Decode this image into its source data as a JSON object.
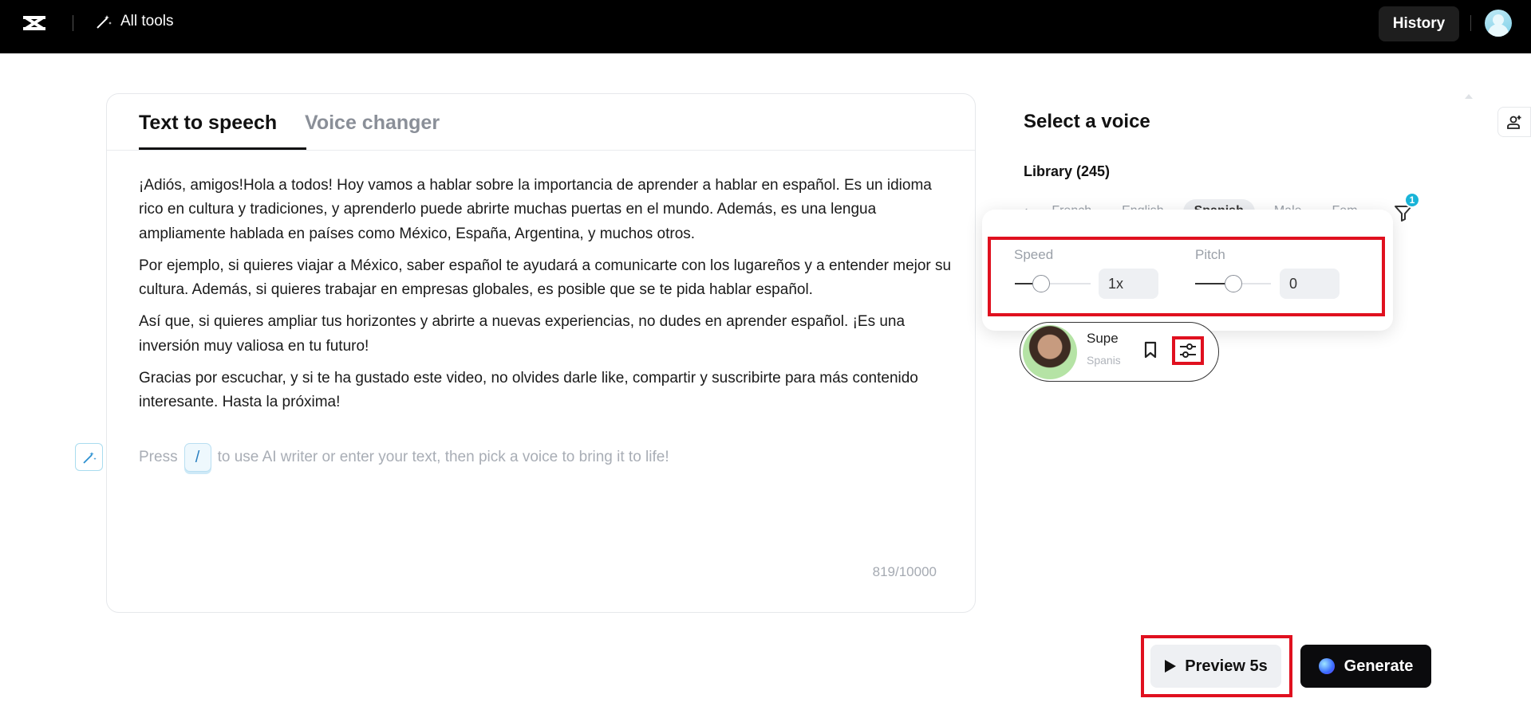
{
  "topbar": {
    "logo_icon": "capcut-logo-icon",
    "all_tools_label": "All tools",
    "all_tools_icon": "magic-wand-icon",
    "history_label": "History",
    "avatar": "user-avatar"
  },
  "editor": {
    "tabs": [
      {
        "label": "Text to speech",
        "active": true
      },
      {
        "label": "Voice changer",
        "active": false
      }
    ],
    "paragraphs": [
      " ¡Adiós, amigos!Hola a todos! Hoy vamos a hablar sobre la importancia de aprender a hablar en español. Es un idioma rico en cultura y tradiciones, y aprenderlo puede abrirte muchas puertas en el mundo. Además, es una lengua ampliamente hablada en países como México, España, Argentina, y muchos otros.",
      "Por ejemplo, si quieres viajar a México, saber español te ayudará a comunicarte con los lugareños y a entender mejor su cultura. Además, si quieres trabajar en empresas globales, es posible que se te pida hablar español.",
      "Así que, si quieres ampliar tus horizontes y abrirte a nuevas experiencias, no dudes en aprender español. ¡Es una inversión muy valiosa en tu futuro!",
      "Gracias por escuchar, y si te ha gustado este video, no olvides darle like, compartir y suscribirte para más contenido interesante. Hasta la próxima!"
    ],
    "placeholder_before": "Press",
    "placeholder_key": "/",
    "placeholder_after": "to use AI writer or enter your text, then pick a voice to bring it to life!",
    "char_count": "819/10000"
  },
  "voice_panel": {
    "title": "Select a voice",
    "library_label": "Library (245)",
    "filter_chips": [
      "French",
      "English",
      "Spanish",
      "Male",
      "Fem"
    ],
    "active_chip": "Spanish",
    "filter_badge": "1",
    "settings_popover": {
      "speed_label": "Speed",
      "speed_value": "1x",
      "speed_level": 0.3,
      "pitch_label": "Pitch",
      "pitch_value": "0",
      "pitch_level": 0.5
    },
    "voice_card": {
      "name": "Supe",
      "language": "Spanis"
    }
  },
  "actions": {
    "preview_label": "Preview 5s",
    "generate_label": "Generate"
  },
  "colors": {
    "highlight_red": "#e0101f",
    "badge_cyan": "#19b4d8"
  }
}
